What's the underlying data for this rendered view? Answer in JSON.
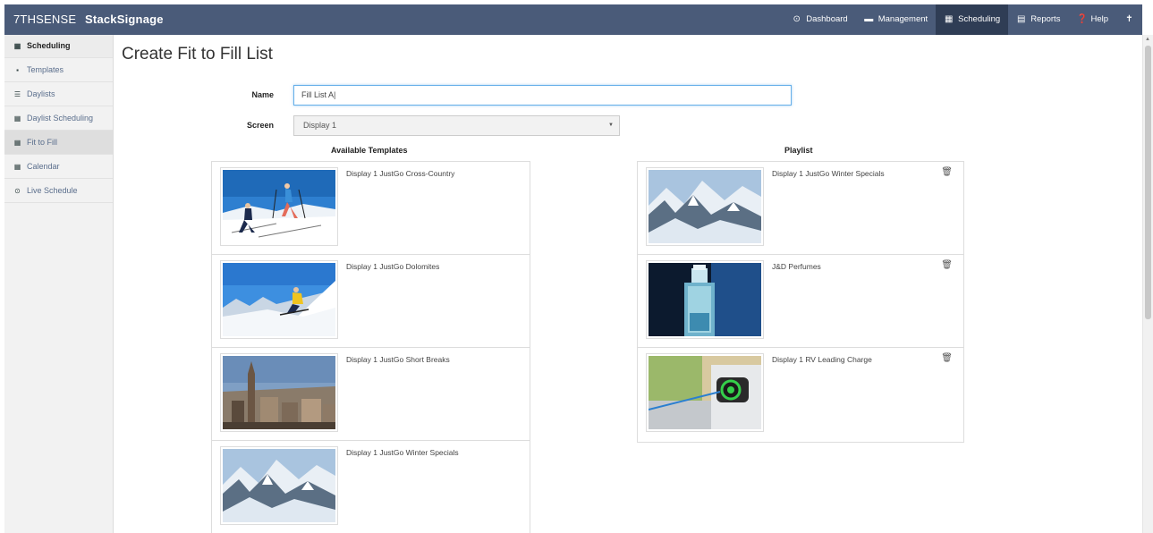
{
  "navbar": {
    "brand_logo": "7THSENSE",
    "brand_app": "StackSignage",
    "items": [
      {
        "label": "Dashboard",
        "icon": "⊙"
      },
      {
        "label": "Management",
        "icon": "▬"
      },
      {
        "label": "Scheduling",
        "icon": "▦"
      },
      {
        "label": "Reports",
        "icon": "▤"
      },
      {
        "label": "Help",
        "icon": "❓"
      },
      {
        "label": "",
        "icon": "✝"
      }
    ]
  },
  "sidebar": {
    "header": "Scheduling",
    "items": [
      {
        "label": "Templates",
        "icon": "▪"
      },
      {
        "label": "Daylists",
        "icon": "☰"
      },
      {
        "label": "Daylist Scheduling",
        "icon": "▦"
      },
      {
        "label": "Fit to Fill",
        "icon": "▦"
      },
      {
        "label": "Calendar",
        "icon": "▦"
      },
      {
        "label": "Live Schedule",
        "icon": "⊙"
      }
    ]
  },
  "main": {
    "title": "Create Fit to Fill List",
    "name_label": "Name",
    "name_value": "Fill List A|",
    "screen_label": "Screen",
    "screen_value": "Display 1"
  },
  "available": {
    "title": "Available Templates",
    "items": [
      {
        "label": "Display 1 JustGo Cross-Country"
      },
      {
        "label": "Display 1 JustGo Dolomites"
      },
      {
        "label": "Display 1 JustGo Short Breaks"
      },
      {
        "label": "Display 1 JustGo Winter Specials"
      }
    ]
  },
  "playlist": {
    "title": "Playlist",
    "items": [
      {
        "label": "Display 1 JustGo Winter Specials"
      },
      {
        "label": "J&D Perfumes"
      },
      {
        "label": "Display 1 RV Leading Charge"
      }
    ]
  },
  "icons": {
    "trash": "🗑"
  },
  "colors": {
    "navbar": "#4a5b79",
    "navbar_active": "#2f3d55",
    "sidebar_link": "#5a6e8c",
    "input_focus": "#66afe9"
  }
}
